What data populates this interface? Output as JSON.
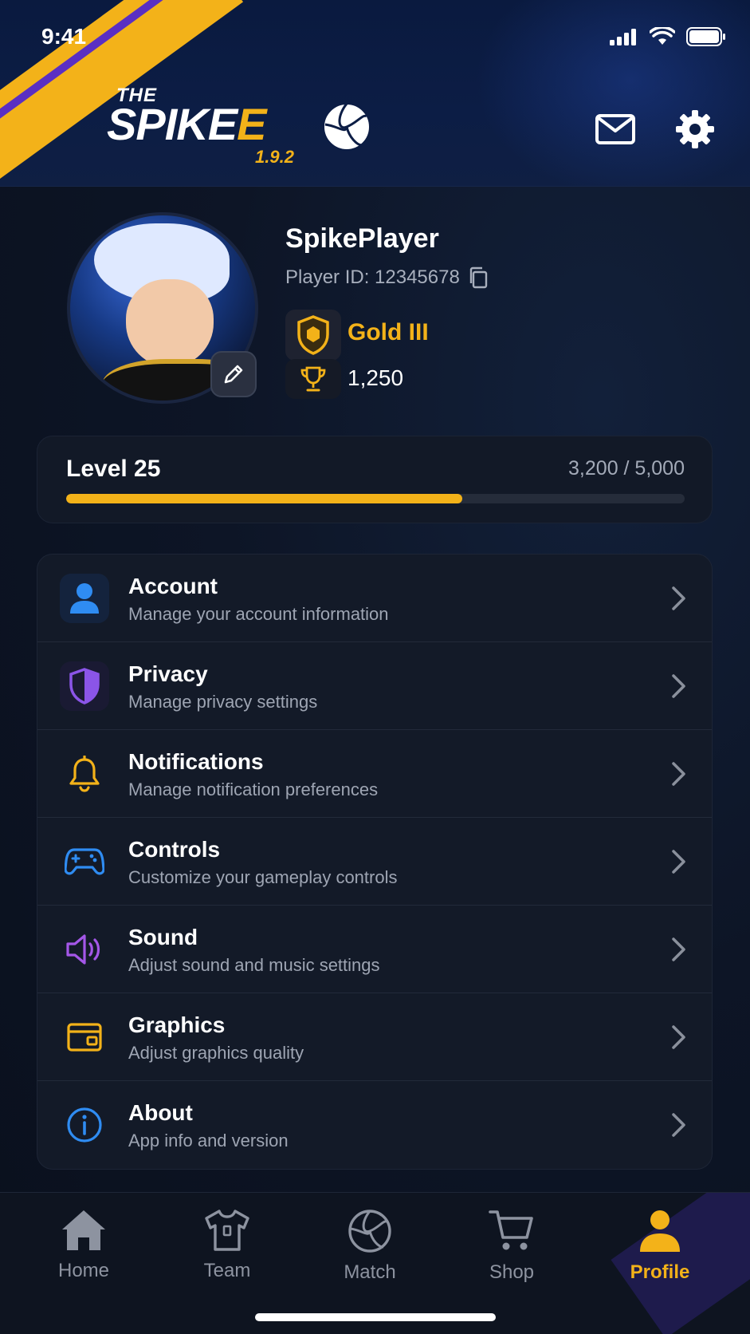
{
  "status_bar": {
    "time": "9:41"
  },
  "header": {
    "logo_the": "THE",
    "logo_spike": "SPIKE",
    "logo_e": "E",
    "version": "1.9.2",
    "mail_icon": "mail-icon",
    "settings_icon": "gear-icon"
  },
  "profile": {
    "name": "SpikePlayer",
    "player_id": "Player ID: 12345678",
    "rank": "Gold III",
    "trophies": "1,250"
  },
  "level": {
    "label": "Level 25",
    "xp": "3,200 / 5,000",
    "progress": 0.64
  },
  "menu": {
    "items": [
      {
        "title": "Account",
        "subtitle": "Manage your account information",
        "icon": "user-icon",
        "color": "#2f8cf2"
      },
      {
        "title": "Privacy",
        "subtitle": "Manage privacy settings",
        "icon": "shield-icon",
        "color": "#8b55e8"
      },
      {
        "title": "Notifications",
        "subtitle": "Manage notification preferences",
        "icon": "bell-icon",
        "color": "#f3b219"
      },
      {
        "title": "Controls",
        "subtitle": "Customize your gameplay controls",
        "icon": "gamepad-icon",
        "color": "#2f8cf2"
      },
      {
        "title": "Sound",
        "subtitle": "Adjust sound and music settings",
        "icon": "speaker-icon",
        "color": "#a457e8"
      },
      {
        "title": "Graphics",
        "subtitle": "Adjust graphics quality",
        "icon": "graphics-card-icon",
        "color": "#f3b219"
      },
      {
        "title": "About",
        "subtitle": "App info and version",
        "icon": "info-icon",
        "color": "#2f8cf2"
      }
    ]
  },
  "bottom_nav": {
    "items": [
      {
        "label": "Home",
        "icon": "home-icon"
      },
      {
        "label": "Team",
        "icon": "jersey-icon"
      },
      {
        "label": "Match",
        "icon": "volleyball-icon"
      },
      {
        "label": "Shop",
        "icon": "cart-icon"
      },
      {
        "label": "Profile",
        "icon": "person-icon",
        "active": true
      }
    ]
  },
  "colors": {
    "accent": "#f3b219",
    "background": "#0c1322",
    "card": "#131a28"
  }
}
